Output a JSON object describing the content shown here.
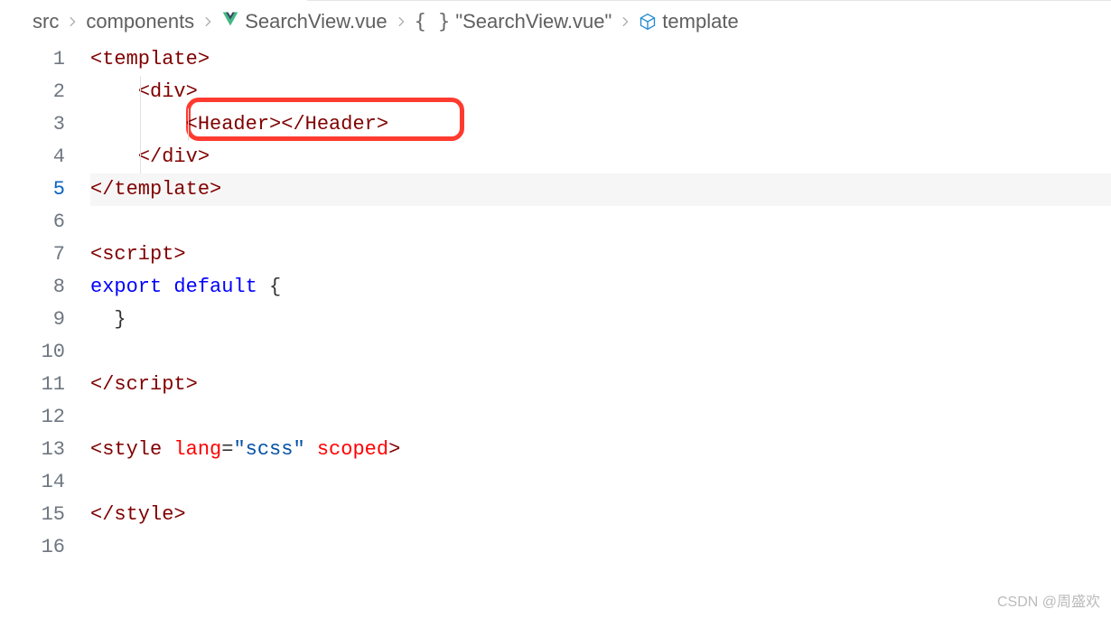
{
  "breadcrumb": {
    "items": [
      {
        "label": "src",
        "icon": null
      },
      {
        "label": "components",
        "icon": null
      },
      {
        "label": "SearchView.vue",
        "icon": "vue"
      },
      {
        "label": "\"SearchView.vue\"",
        "icon": "braces"
      },
      {
        "label": "template",
        "icon": "cube"
      }
    ]
  },
  "editor": {
    "active_line": 5,
    "lines": [
      {
        "n": 1,
        "indent": 0,
        "segs": [
          {
            "t": "<template>",
            "c": "tag"
          }
        ]
      },
      {
        "n": 2,
        "indent": 1,
        "segs": [
          {
            "t": "<div>",
            "c": "tag"
          }
        ]
      },
      {
        "n": 3,
        "indent": 2,
        "segs": [
          {
            "t": "<Header></Header>",
            "c": "tag"
          }
        ]
      },
      {
        "n": 4,
        "indent": 1,
        "segs": [
          {
            "t": "</div>",
            "c": "tag"
          }
        ]
      },
      {
        "n": 5,
        "indent": 0,
        "segs": [
          {
            "t": "</template>",
            "c": "tag"
          }
        ]
      },
      {
        "n": 6,
        "indent": 0,
        "segs": []
      },
      {
        "n": 7,
        "indent": 0,
        "segs": [
          {
            "t": "<script>",
            "c": "tag"
          }
        ]
      },
      {
        "n": 8,
        "indent": 0,
        "segs": [
          {
            "t": "export",
            "c": "keyword"
          },
          {
            "t": " ",
            "c": ""
          },
          {
            "t": "default",
            "c": "keyword"
          },
          {
            "t": " {",
            "c": ""
          }
        ]
      },
      {
        "n": 9,
        "indent": 0,
        "segs": [
          {
            "t": "  }",
            "c": ""
          }
        ]
      },
      {
        "n": 10,
        "indent": 0,
        "segs": []
      },
      {
        "n": 11,
        "indent": 0,
        "segs": [
          {
            "t": "</script>",
            "c": "tag"
          }
        ]
      },
      {
        "n": 12,
        "indent": 0,
        "segs": []
      },
      {
        "n": 13,
        "indent": 0,
        "segs": [
          {
            "t": "<style ",
            "c": "tag"
          },
          {
            "t": "lang",
            "c": "attr"
          },
          {
            "t": "=",
            "c": ""
          },
          {
            "t": "\"scss\"",
            "c": "string"
          },
          {
            "t": " ",
            "c": ""
          },
          {
            "t": "scoped",
            "c": "attr"
          },
          {
            "t": ">",
            "c": "tag"
          }
        ]
      },
      {
        "n": 14,
        "indent": 0,
        "segs": []
      },
      {
        "n": 15,
        "indent": 0,
        "segs": [
          {
            "t": "</style>",
            "c": "tag"
          }
        ]
      },
      {
        "n": 16,
        "indent": 0,
        "segs": []
      }
    ]
  },
  "watermark": "CSDN @周盛欢"
}
